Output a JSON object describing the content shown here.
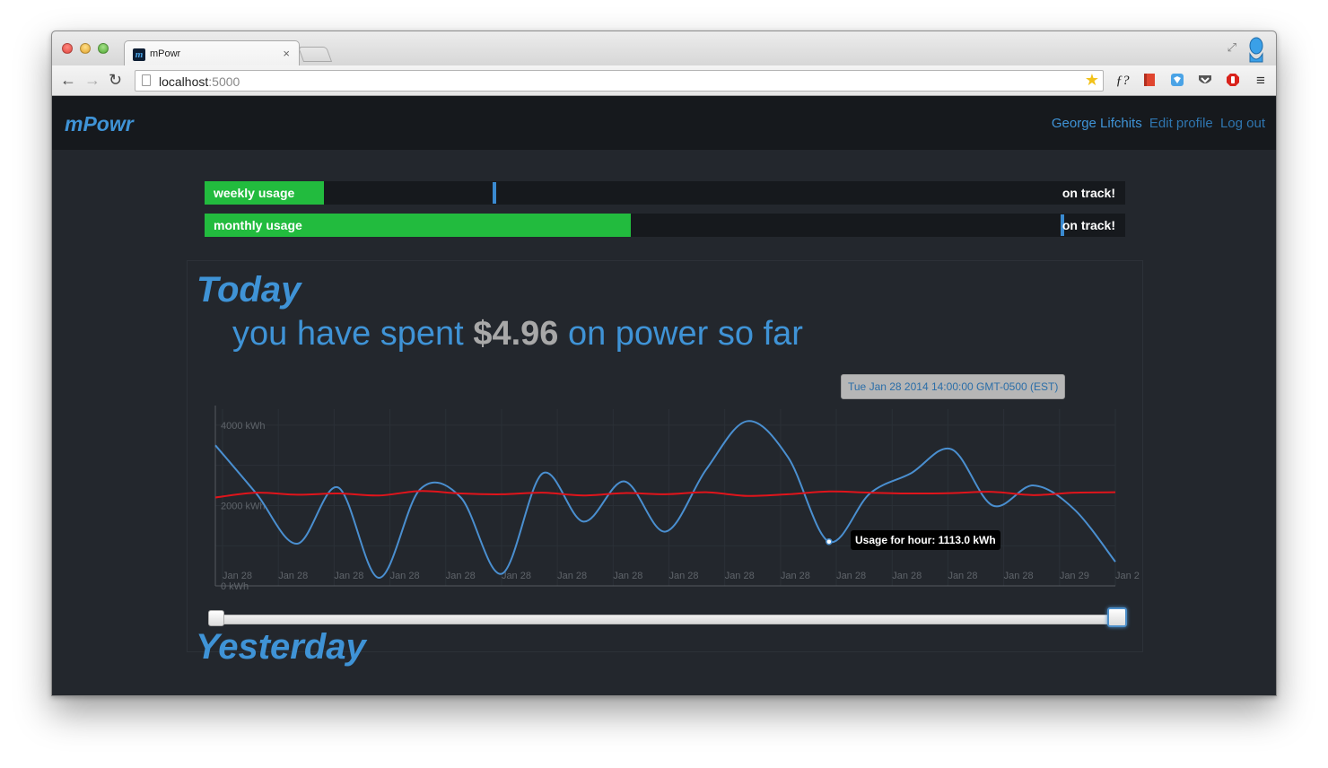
{
  "browser": {
    "tab_title": "mPowr",
    "tab_close": "×",
    "favicon_letter": "m",
    "url_host": "localhost",
    "url_port": ":5000",
    "star": "★"
  },
  "navbar": {
    "brand": "mPowr",
    "user": "George Lifchits",
    "edit_profile": "Edit profile",
    "logout": "Log out"
  },
  "usage": [
    {
      "label": "weekly usage",
      "fill_fraction": 0.13,
      "marker_fraction": 0.313,
      "status": "on track!"
    },
    {
      "label": "monthly usage",
      "fill_fraction": 0.463,
      "marker_fraction": 0.93,
      "status": "on track!"
    }
  ],
  "today": {
    "title": "Today",
    "spent_prefix": "you have spent",
    "amount": "$4.96",
    "spent_suffix": "on power so far"
  },
  "tooltips": {
    "date": "Tue Jan 28 2014 14:00:00 GMT-0500 (EST)",
    "usage": "Usage for hour: 1113.0 kWh"
  },
  "chart_data": {
    "type": "line",
    "y_ticks": [
      "4000 kWh",
      "2000 kWh",
      "0 kWh"
    ],
    "ylim": [
      0,
      4400
    ],
    "x_ticks": [
      "Jan 28",
      "Jan 28",
      "Jan 28",
      "Jan 28",
      "Jan 28",
      "Jan 28",
      "Jan 28",
      "Jan 28",
      "Jan 28",
      "Jan 28",
      "Jan 28",
      "Jan 28",
      "Jan 28",
      "Jan 28",
      "Jan 28",
      "Jan 29",
      "Jan 2"
    ],
    "series": [
      {
        "color": "#4a8fd0",
        "values": [
          3500,
          2300,
          1050,
          2450,
          200,
          2400,
          2200,
          300,
          2800,
          1600,
          2600,
          1350,
          2900,
          4100,
          3200,
          1100,
          2300,
          2800,
          3400,
          2000,
          2500,
          1900,
          600
        ]
      },
      {
        "color": "#e0141b",
        "values": [
          2200,
          2320,
          2270,
          2300,
          2250,
          2360,
          2300,
          2280,
          2320,
          2250,
          2310,
          2280,
          2330,
          2240,
          2280,
          2350,
          2320,
          2300,
          2310,
          2340,
          2260,
          2320,
          2330
        ]
      }
    ],
    "highlight_value": 1113.0,
    "grid": true
  },
  "yesterday": {
    "title": "Yesterday"
  }
}
